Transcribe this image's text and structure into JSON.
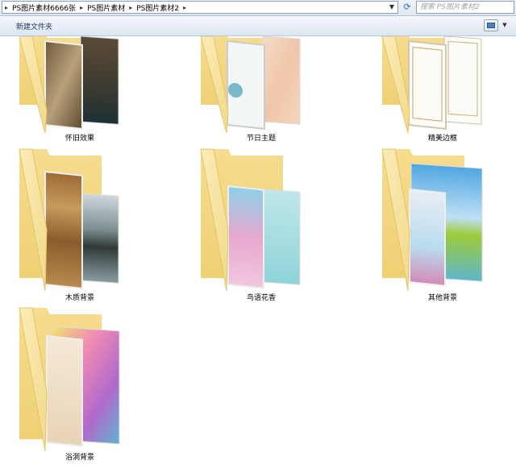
{
  "address": {
    "crumbs": [
      "PS图片素材6666张",
      "PS图片素材",
      "PS图片素材2"
    ]
  },
  "search": {
    "placeholder": "搜索 PS图片素材2"
  },
  "toolbar": {
    "new_folder_label": "新建文件夹"
  },
  "folders": [
    {
      "label": "怀旧效果",
      "icon": "folder-icon"
    },
    {
      "label": "节日主题",
      "icon": "folder-icon"
    },
    {
      "label": "精美边框",
      "icon": "folder-icon"
    },
    {
      "label": "木质背景",
      "icon": "folder-icon"
    },
    {
      "label": "鸟语花香",
      "icon": "folder-icon"
    },
    {
      "label": "其他背景",
      "icon": "folder-icon"
    },
    {
      "label": "浴洞背景",
      "icon": "folder-icon"
    }
  ]
}
